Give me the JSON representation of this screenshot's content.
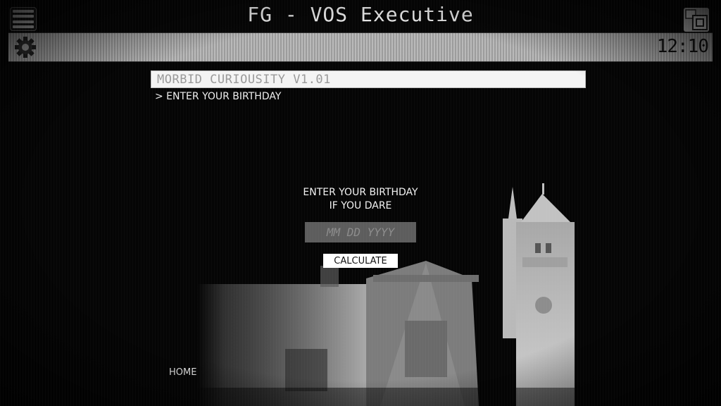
{
  "window": {
    "title": "FG - VOS Executive",
    "menu_icon": "hamburger-menu-icon",
    "window_icon": "window-cascade-icon"
  },
  "statusbar": {
    "settings_icon": "gear-icon",
    "clock": "12:10"
  },
  "app": {
    "title": "MORBID CURIOUSITY V1.01",
    "breadcrumb": "> ENTER YOUR BIRTHDAY"
  },
  "form": {
    "prompt_line1": "ENTER YOUR BIRTHDAY",
    "prompt_line2": "IF YOU DARE",
    "birthday_value": "",
    "birthday_placeholder": "MM DD YYYY",
    "calculate_label": "CALCULATE"
  },
  "footer": {
    "home_label": "HOME"
  },
  "colors": {
    "background": "#050505",
    "statusbar": "#b0b0b0",
    "input_bg": "#5d5d5d",
    "button_bg": "#ffffff"
  }
}
